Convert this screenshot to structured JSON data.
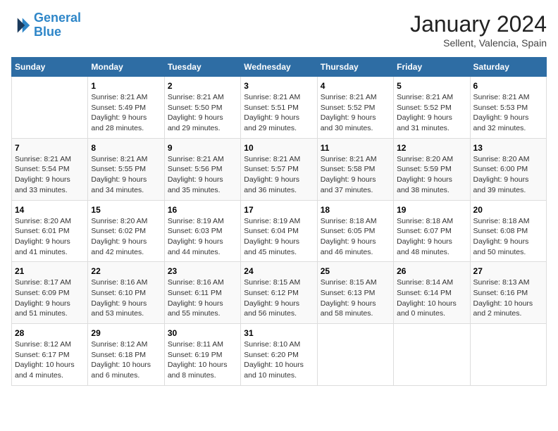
{
  "header": {
    "logo_line1": "General",
    "logo_line2": "Blue",
    "title": "January 2024",
    "subtitle": "Sellent, Valencia, Spain"
  },
  "days_of_week": [
    "Sunday",
    "Monday",
    "Tuesday",
    "Wednesday",
    "Thursday",
    "Friday",
    "Saturday"
  ],
  "weeks": [
    [
      {
        "day": "",
        "info": ""
      },
      {
        "day": "1",
        "info": "Sunrise: 8:21 AM\nSunset: 5:49 PM\nDaylight: 9 hours\nand 28 minutes."
      },
      {
        "day": "2",
        "info": "Sunrise: 8:21 AM\nSunset: 5:50 PM\nDaylight: 9 hours\nand 29 minutes."
      },
      {
        "day": "3",
        "info": "Sunrise: 8:21 AM\nSunset: 5:51 PM\nDaylight: 9 hours\nand 29 minutes."
      },
      {
        "day": "4",
        "info": "Sunrise: 8:21 AM\nSunset: 5:52 PM\nDaylight: 9 hours\nand 30 minutes."
      },
      {
        "day": "5",
        "info": "Sunrise: 8:21 AM\nSunset: 5:52 PM\nDaylight: 9 hours\nand 31 minutes."
      },
      {
        "day": "6",
        "info": "Sunrise: 8:21 AM\nSunset: 5:53 PM\nDaylight: 9 hours\nand 32 minutes."
      }
    ],
    [
      {
        "day": "7",
        "info": "Sunrise: 8:21 AM\nSunset: 5:54 PM\nDaylight: 9 hours\nand 33 minutes."
      },
      {
        "day": "8",
        "info": "Sunrise: 8:21 AM\nSunset: 5:55 PM\nDaylight: 9 hours\nand 34 minutes."
      },
      {
        "day": "9",
        "info": "Sunrise: 8:21 AM\nSunset: 5:56 PM\nDaylight: 9 hours\nand 35 minutes."
      },
      {
        "day": "10",
        "info": "Sunrise: 8:21 AM\nSunset: 5:57 PM\nDaylight: 9 hours\nand 36 minutes."
      },
      {
        "day": "11",
        "info": "Sunrise: 8:21 AM\nSunset: 5:58 PM\nDaylight: 9 hours\nand 37 minutes."
      },
      {
        "day": "12",
        "info": "Sunrise: 8:20 AM\nSunset: 5:59 PM\nDaylight: 9 hours\nand 38 minutes."
      },
      {
        "day": "13",
        "info": "Sunrise: 8:20 AM\nSunset: 6:00 PM\nDaylight: 9 hours\nand 39 minutes."
      }
    ],
    [
      {
        "day": "14",
        "info": "Sunrise: 8:20 AM\nSunset: 6:01 PM\nDaylight: 9 hours\nand 41 minutes."
      },
      {
        "day": "15",
        "info": "Sunrise: 8:20 AM\nSunset: 6:02 PM\nDaylight: 9 hours\nand 42 minutes."
      },
      {
        "day": "16",
        "info": "Sunrise: 8:19 AM\nSunset: 6:03 PM\nDaylight: 9 hours\nand 44 minutes."
      },
      {
        "day": "17",
        "info": "Sunrise: 8:19 AM\nSunset: 6:04 PM\nDaylight: 9 hours\nand 45 minutes."
      },
      {
        "day": "18",
        "info": "Sunrise: 8:18 AM\nSunset: 6:05 PM\nDaylight: 9 hours\nand 46 minutes."
      },
      {
        "day": "19",
        "info": "Sunrise: 8:18 AM\nSunset: 6:07 PM\nDaylight: 9 hours\nand 48 minutes."
      },
      {
        "day": "20",
        "info": "Sunrise: 8:18 AM\nSunset: 6:08 PM\nDaylight: 9 hours\nand 50 minutes."
      }
    ],
    [
      {
        "day": "21",
        "info": "Sunrise: 8:17 AM\nSunset: 6:09 PM\nDaylight: 9 hours\nand 51 minutes."
      },
      {
        "day": "22",
        "info": "Sunrise: 8:16 AM\nSunset: 6:10 PM\nDaylight: 9 hours\nand 53 minutes."
      },
      {
        "day": "23",
        "info": "Sunrise: 8:16 AM\nSunset: 6:11 PM\nDaylight: 9 hours\nand 55 minutes."
      },
      {
        "day": "24",
        "info": "Sunrise: 8:15 AM\nSunset: 6:12 PM\nDaylight: 9 hours\nand 56 minutes."
      },
      {
        "day": "25",
        "info": "Sunrise: 8:15 AM\nSunset: 6:13 PM\nDaylight: 9 hours\nand 58 minutes."
      },
      {
        "day": "26",
        "info": "Sunrise: 8:14 AM\nSunset: 6:14 PM\nDaylight: 10 hours\nand 0 minutes."
      },
      {
        "day": "27",
        "info": "Sunrise: 8:13 AM\nSunset: 6:16 PM\nDaylight: 10 hours\nand 2 minutes."
      }
    ],
    [
      {
        "day": "28",
        "info": "Sunrise: 8:12 AM\nSunset: 6:17 PM\nDaylight: 10 hours\nand 4 minutes."
      },
      {
        "day": "29",
        "info": "Sunrise: 8:12 AM\nSunset: 6:18 PM\nDaylight: 10 hours\nand 6 minutes."
      },
      {
        "day": "30",
        "info": "Sunrise: 8:11 AM\nSunset: 6:19 PM\nDaylight: 10 hours\nand 8 minutes."
      },
      {
        "day": "31",
        "info": "Sunrise: 8:10 AM\nSunset: 6:20 PM\nDaylight: 10 hours\nand 10 minutes."
      },
      {
        "day": "",
        "info": ""
      },
      {
        "day": "",
        "info": ""
      },
      {
        "day": "",
        "info": ""
      }
    ]
  ]
}
